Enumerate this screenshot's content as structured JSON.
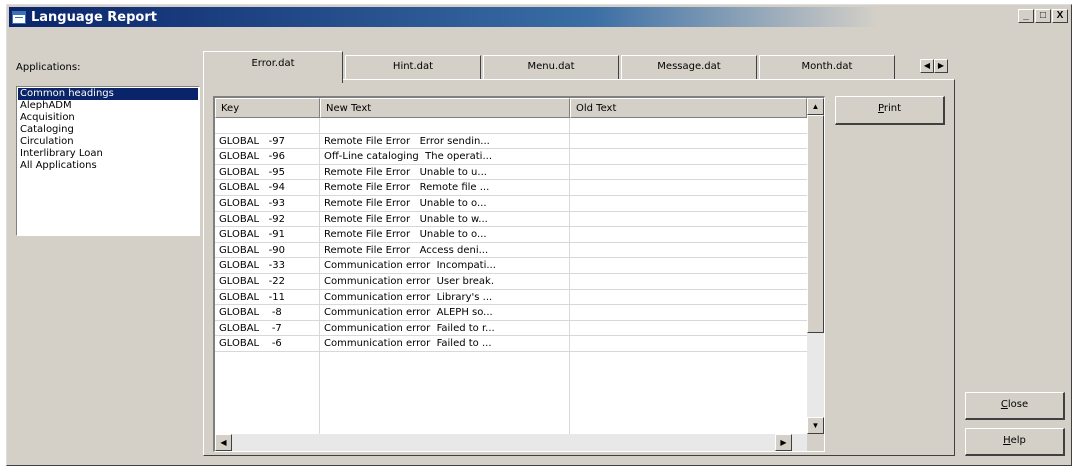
{
  "window": {
    "title": "Language Report",
    "controls": [
      "_",
      "□",
      "X"
    ]
  },
  "applications": {
    "label": "Applications:",
    "items": [
      "Common headings",
      "AlephADM",
      "Acquisition",
      "Cataloging",
      "Circulation",
      "Interlibrary Loan",
      "All Applications"
    ],
    "selected": "Common headings"
  },
  "tabs": [
    "Error.dat",
    "Hint.dat",
    "Menu.dat",
    "Message.dat",
    "Month.dat"
  ],
  "active_tab": "Error.dat",
  "tab_scroll": {
    "left": "◀",
    "right": "▶"
  },
  "grid": {
    "columns": [
      "Key",
      "New Text",
      "Old Text"
    ],
    "rows": [
      {
        "key": "",
        "new": "",
        "old": ""
      },
      {
        "key": "GLOBAL   -97",
        "new": "Remote File Error   Error sendin...",
        "old": ""
      },
      {
        "key": "GLOBAL   -96",
        "new": "Off-Line cataloging  The operati...",
        "old": ""
      },
      {
        "key": "GLOBAL   -95",
        "new": "Remote File Error   Unable to u...",
        "old": ""
      },
      {
        "key": "GLOBAL   -94",
        "new": "Remote File Error   Remote file ...",
        "old": ""
      },
      {
        "key": "GLOBAL   -93",
        "new": "Remote File Error   Unable to o...",
        "old": ""
      },
      {
        "key": "GLOBAL   -92",
        "new": "Remote File Error   Unable to w...",
        "old": ""
      },
      {
        "key": "GLOBAL   -91",
        "new": "Remote File Error   Unable to o...",
        "old": ""
      },
      {
        "key": "GLOBAL   -90",
        "new": "Remote File Error   Access deni...",
        "old": ""
      },
      {
        "key": "GLOBAL   -33",
        "new": "Communication error  Incompati...",
        "old": ""
      },
      {
        "key": "GLOBAL   -22",
        "new": "Communication error  User break.",
        "old": ""
      },
      {
        "key": "GLOBAL   -11",
        "new": "Communication error  Library's ...",
        "old": ""
      },
      {
        "key": "GLOBAL    -8",
        "new": "Communication error  ALEPH so...",
        "old": ""
      },
      {
        "key": "GLOBAL    -7",
        "new": "Communication error  Failed to r...",
        "old": ""
      },
      {
        "key": "GLOBAL    -6",
        "new": "Communication error  Failed to ...",
        "old": ""
      }
    ]
  },
  "buttons": {
    "print": {
      "underline": "P",
      "rest": "rint"
    },
    "close": {
      "underline": "C",
      "rest": "lose"
    },
    "help": {
      "underline": "H",
      "rest": "elp"
    }
  },
  "scroll": {
    "up": "▲",
    "down": "▼",
    "left": "◀",
    "right": "▶"
  }
}
